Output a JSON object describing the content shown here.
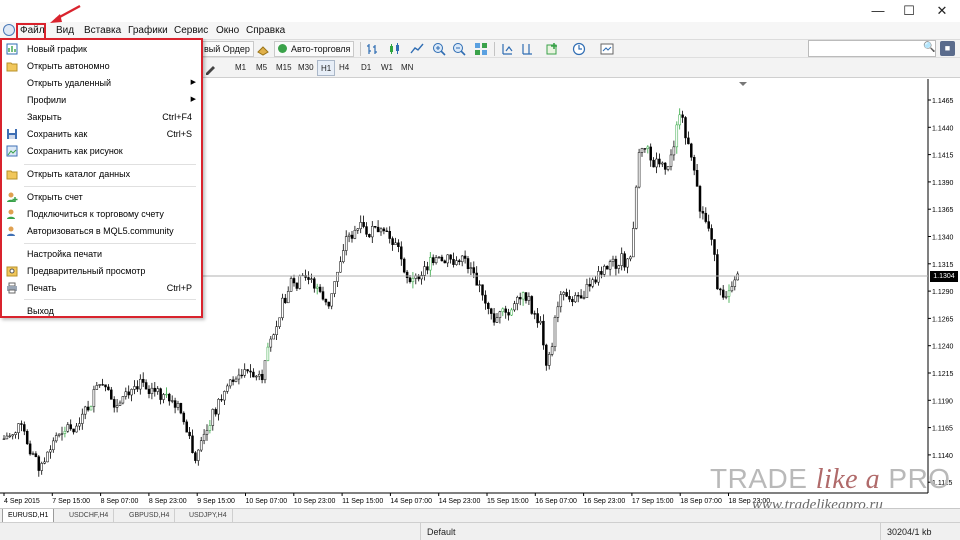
{
  "window": {
    "controls": {
      "minimize": "—",
      "maximize": "☐",
      "close": "✕"
    }
  },
  "menubar": {
    "items": [
      {
        "label": "Файл"
      },
      {
        "label": "Вид"
      },
      {
        "label": "Вставка"
      },
      {
        "label": "Графики"
      },
      {
        "label": "Сервис"
      },
      {
        "label": "Окно"
      },
      {
        "label": "Справка"
      }
    ]
  },
  "toolbar": {
    "new_order": "вый Ордер",
    "auto_trading": "Авто-торговля",
    "timeframes": [
      "M1",
      "M5",
      "M15",
      "M30",
      "H1",
      "H4",
      "D1",
      "W1",
      "MN"
    ],
    "active_timeframe": "H1"
  },
  "file_menu": {
    "items": [
      {
        "label": "Новый график",
        "shortcut": "",
        "icon": "new-chart-icon"
      },
      {
        "label": "Открыть автономно",
        "shortcut": "",
        "icon": "folder-open-icon"
      },
      {
        "label": "Открыть удаленный",
        "shortcut": "",
        "submenu": true
      },
      {
        "label": "Профили",
        "shortcut": "",
        "submenu": true
      },
      {
        "label": "Закрыть",
        "shortcut": "Ctrl+F4"
      },
      {
        "label": "Сохранить как",
        "shortcut": "Ctrl+S",
        "icon": "save-icon"
      },
      {
        "label": "Сохранить как рисунок",
        "shortcut": "",
        "icon": "save-picture-icon"
      },
      {
        "label": "Открыть каталог данных",
        "shortcut": "",
        "icon": "data-folder-icon"
      },
      {
        "label": "Открыть счет",
        "shortcut": "",
        "icon": "open-account-icon"
      },
      {
        "label": "Подключиться к торговому счету",
        "shortcut": "",
        "icon": "connect-account-icon"
      },
      {
        "label": "Авторизоваться в MQL5.community",
        "shortcut": "",
        "icon": "mql5-login-icon"
      },
      {
        "label": "Настройка печати",
        "shortcut": ""
      },
      {
        "label": "Предварительный просмотр",
        "shortcut": "",
        "icon": "print-preview-icon"
      },
      {
        "label": "Печать",
        "shortcut": "Ctrl+P",
        "icon": "printer-icon"
      },
      {
        "label": "Выход",
        "shortcut": ""
      }
    ]
  },
  "chart": {
    "symbol": "EURUSD,H1",
    "current_price": "1.1304",
    "price_labels": [
      "1.1465",
      "1.1440",
      "1.1415",
      "1.1390",
      "1.1365",
      "1.1340",
      "1.1315",
      "1.1290",
      "1.1265",
      "1.1240",
      "1.1215",
      "1.1190",
      "1.1165",
      "1.1140",
      "1.1115"
    ],
    "time_labels": [
      "4 Sep 2015",
      "7 Sep 15:00",
      "8 Sep 07:00",
      "8 Sep 23:00",
      "9 Sep 15:00",
      "10 Sep 07:00",
      "10 Sep 23:00",
      "11 Sep 15:00",
      "14 Sep 07:00",
      "14 Sep 23:00",
      "15 Sep 15:00",
      "16 Sep 07:00",
      "16 Sep 23:00",
      "17 Sep 15:00",
      "18 Sep 07:00",
      "18 Sep 23:00"
    ],
    "bull_color": "#2fa53f",
    "bear_color": "#000000"
  },
  "tabs": [
    {
      "label": "EURUSD,H1",
      "active": true
    },
    {
      "label": "USDCHF,H4",
      "active": false
    },
    {
      "label": "GBPUSD,H4",
      "active": false
    },
    {
      "label": "USDJPY,H4",
      "active": false
    }
  ],
  "status": {
    "profile": "Default",
    "traffic": "30204/1 kb"
  },
  "watermark": {
    "brand_main": "TRADE",
    "brand_italic": "like a",
    "brand_end": "PRO",
    "url": "www.tradelikeapro.ru"
  },
  "colors": {
    "highlight": "#d9232d",
    "menu_bg": "#ffffff"
  }
}
